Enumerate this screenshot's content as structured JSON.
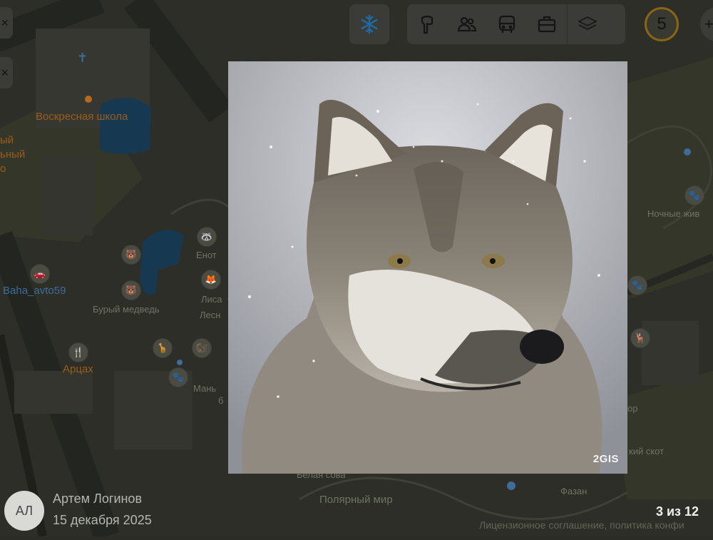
{
  "map": {
    "labels": {
      "sunday_school": "Воскресная школа",
      "partial_1": "ый",
      "partial_2": "ьный",
      "partial_3": "о",
      "baha_avto": "Baha_avto59",
      "brown_bear": "Бурый медведь",
      "raccoon": "Енот",
      "fox": "Лиса",
      "forest": "Лесн",
      "artsakh": "Арцах",
      "mammoth_1": "Мань",
      "mammoth_2": "б",
      "night_animals": "Ночные жив",
      "r_partial_1": "ор",
      "cattle": "кий скот",
      "owl": "Белая сова",
      "polar_world": "Полярный мир",
      "pheasant": "Фазан"
    },
    "license": "Лицензионное соглашение, политика конфи"
  },
  "toolbar": {
    "snowflake_icon": "snowflake-icon",
    "tool_icons": [
      "attraction-icon",
      "people-icon",
      "bus-icon",
      "briefcase-icon",
      "layers-icon"
    ],
    "photo_count_badge": "5",
    "side_buttons": [
      "×",
      "×"
    ],
    "right_control": "+"
  },
  "viewer": {
    "watermark": "2GIS",
    "author_initials": "АЛ",
    "author_name": "Артем Логинов",
    "date": "15 декабря 2025",
    "counter": "3 из 12"
  }
}
